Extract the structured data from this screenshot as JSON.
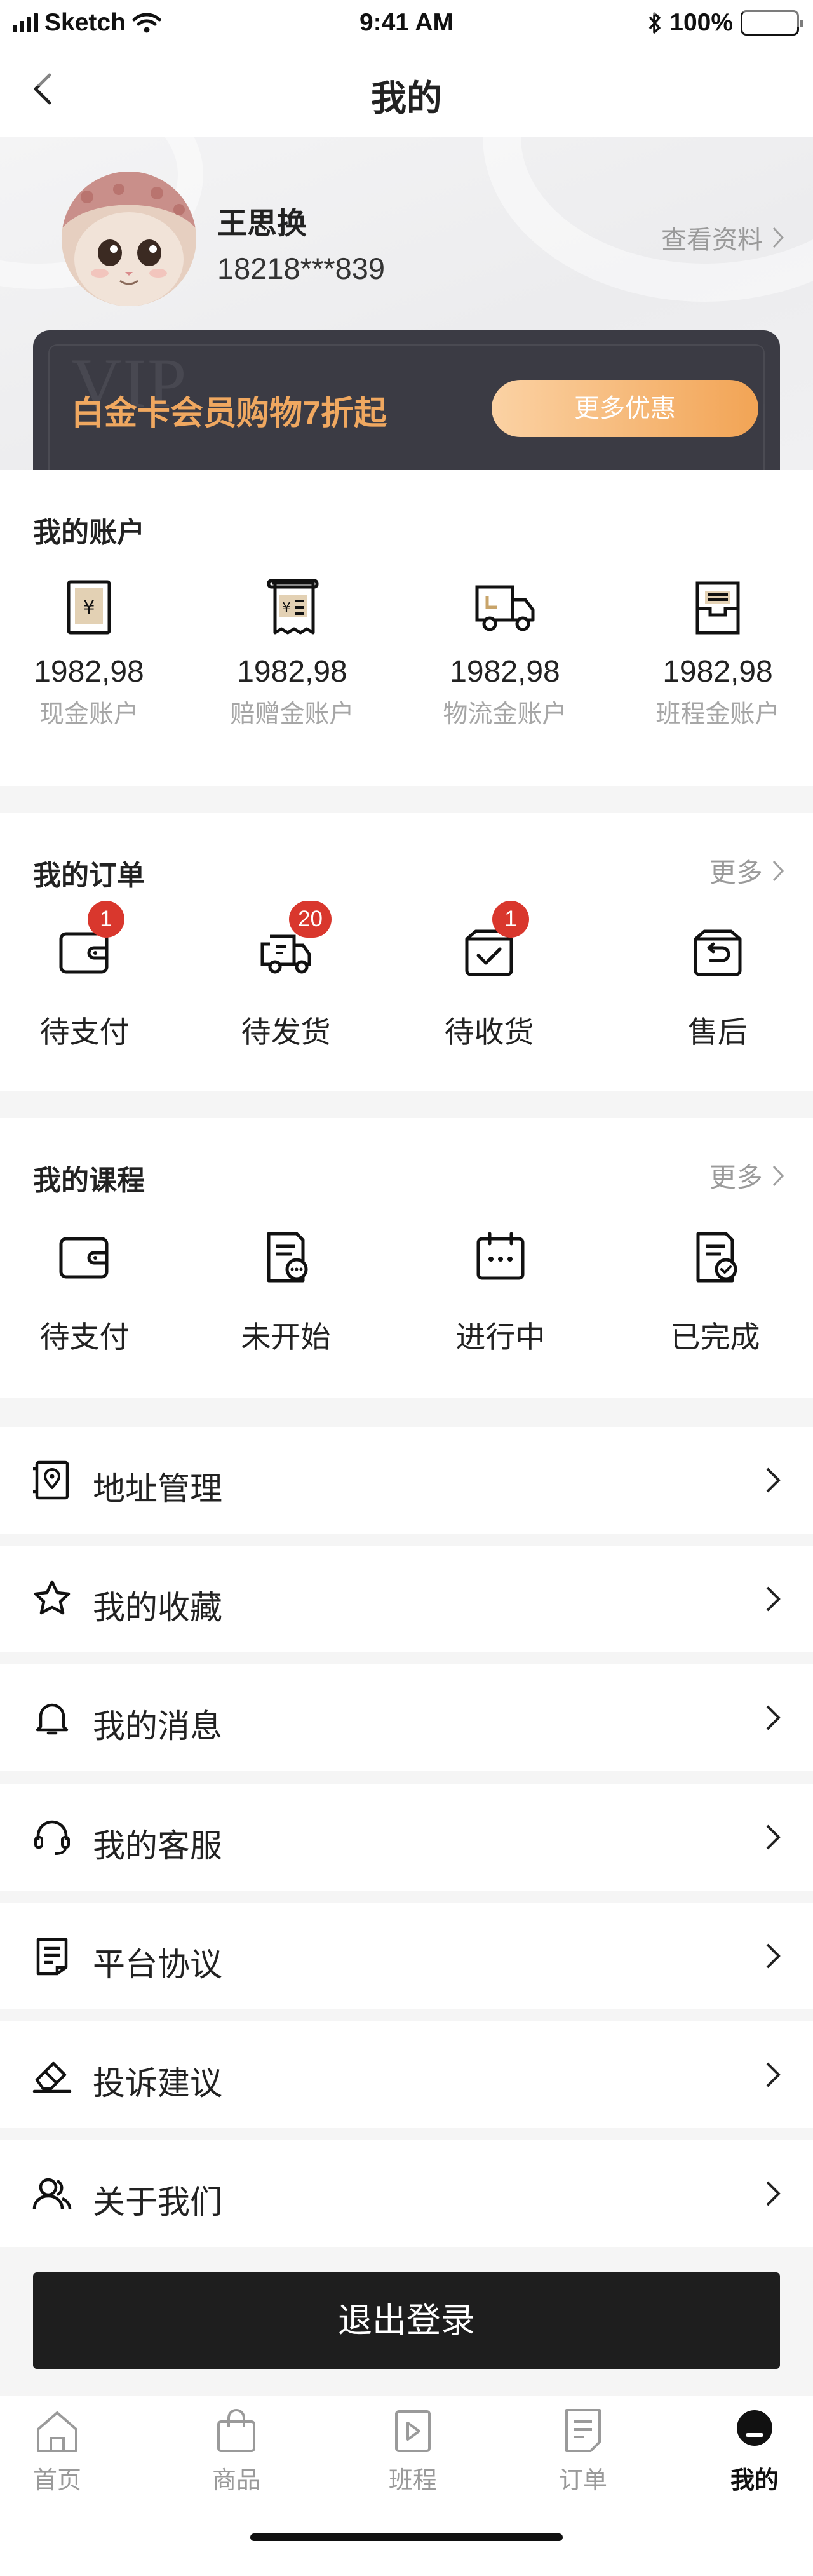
{
  "status_bar": {
    "carrier": "Sketch",
    "time": "9:41 AM",
    "battery": "100%"
  },
  "nav": {
    "title": "我的",
    "back_icon": "back-arrow-icon"
  },
  "profile": {
    "name": "王思换",
    "phone": "18218***839",
    "view_profile": "查看资料",
    "avatar": "cat-avatar"
  },
  "vip": {
    "watermark": "VIP",
    "text": "白金卡会员购物7折起",
    "button": "更多优惠",
    "accent": "#f0a860"
  },
  "accounts": {
    "title": "我的账户",
    "items": [
      {
        "value": "1982,98",
        "label": "现金账户",
        "icon": "cash-icon"
      },
      {
        "value": "1982,98",
        "label": "赔赠金账户",
        "icon": "receipt-icon"
      },
      {
        "value": "1982,98",
        "label": "物流金账户",
        "icon": "truck-icon"
      },
      {
        "value": "1982,98",
        "label": "班程金账户",
        "icon": "inbox-icon"
      }
    ]
  },
  "orders": {
    "title": "我的订单",
    "more": "更多",
    "items": [
      {
        "label": "待支付",
        "badge": "1",
        "icon": "wallet-icon"
      },
      {
        "label": "待发货",
        "badge": "20",
        "icon": "delivery-truck-icon"
      },
      {
        "label": "待收货",
        "badge": "1",
        "icon": "box-check-icon"
      },
      {
        "label": "售后",
        "badge": "",
        "icon": "return-icon"
      }
    ]
  },
  "courses": {
    "title": "我的课程",
    "more": "更多",
    "items": [
      {
        "label": "待支付",
        "icon": "wallet-icon"
      },
      {
        "label": "未开始",
        "icon": "doc-pending-icon"
      },
      {
        "label": "进行中",
        "icon": "calendar-icon"
      },
      {
        "label": "已完成",
        "icon": "doc-done-icon"
      }
    ]
  },
  "menu": [
    {
      "label": "地址管理",
      "icon": "address-book-icon"
    },
    {
      "label": "我的收藏",
      "icon": "star-icon"
    },
    {
      "label": "我的消息",
      "icon": "bell-icon"
    },
    {
      "label": "我的客服",
      "icon": "headset-icon"
    },
    {
      "label": "平台协议",
      "icon": "document-icon"
    },
    {
      "label": "投诉建议",
      "icon": "eraser-icon"
    },
    {
      "label": "关于我们",
      "icon": "users-icon"
    }
  ],
  "logout": "退出登录",
  "tabs": [
    {
      "label": "首页",
      "icon": "home-icon",
      "active": false
    },
    {
      "label": "商品",
      "icon": "bag-icon",
      "active": false
    },
    {
      "label": "班程",
      "icon": "play-icon",
      "active": false
    },
    {
      "label": "订单",
      "icon": "order-icon",
      "active": false
    },
    {
      "label": "我的",
      "icon": "profile-icon",
      "active": true
    }
  ]
}
